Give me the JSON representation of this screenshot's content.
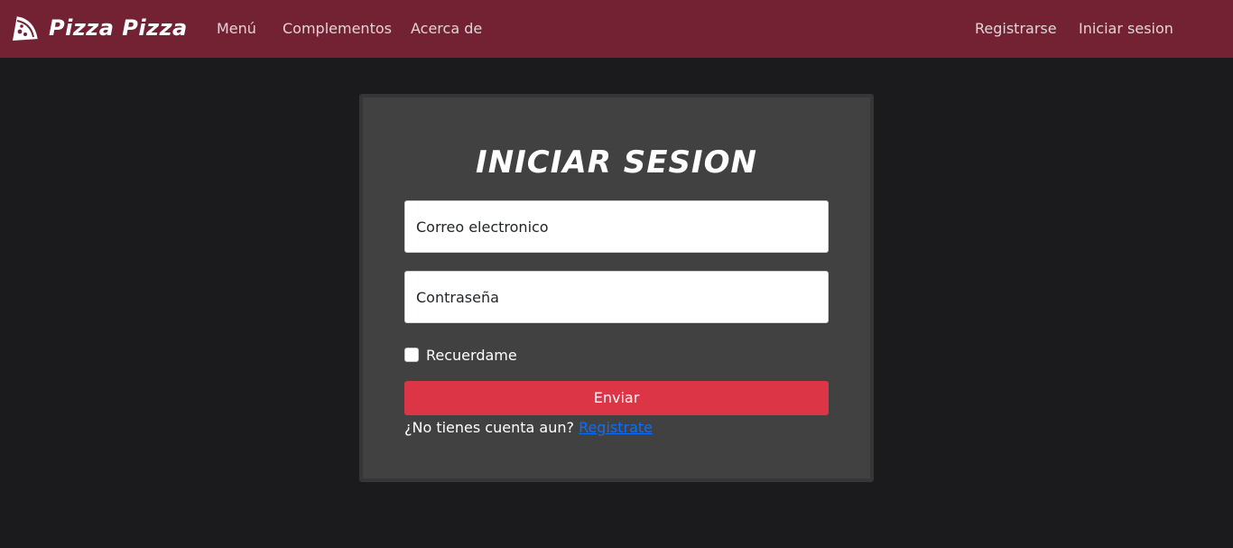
{
  "navbar": {
    "brand": "Pizza Pizza",
    "brand_icon": "pizza-slice-icon",
    "links": [
      "Menú",
      "Complementos",
      "Acerca de"
    ],
    "auth_links": [
      "Registrarse",
      "Iniciar sesion"
    ]
  },
  "form": {
    "title": "INICIAR SESION",
    "email_placeholder": "Correo electronico",
    "password_placeholder": "Contraseña",
    "remember_label": "Recuerdame",
    "remember_checked": false,
    "submit_label": "Enviar",
    "signup_prompt": "¿No tienes cuenta aun?",
    "signup_link": "Registrate"
  },
  "colors": {
    "navbar_bg": "#722233",
    "page_bg": "#1b1b1d",
    "card_bg": "#414141",
    "button_bg": "#dc3545",
    "link": "#0d6efd"
  }
}
